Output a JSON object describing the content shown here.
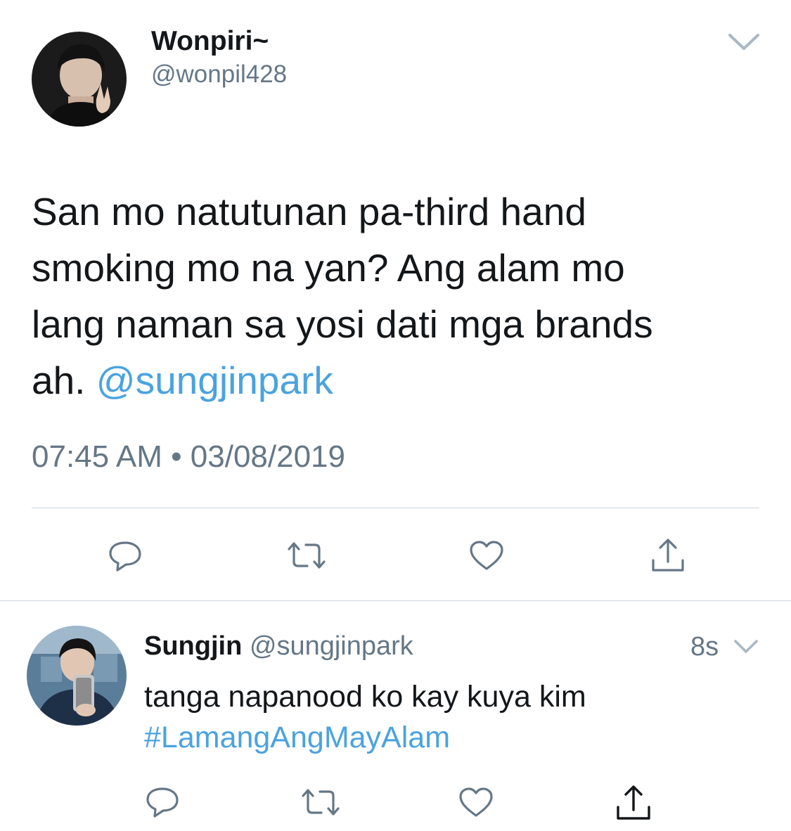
{
  "main_tweet": {
    "display_name": "Wonpiri~",
    "handle": "@wonpil428",
    "text_lines": [
      "San mo natutunan pa-third hand",
      "smoking mo na yan? Ang alam mo",
      "lang naman sa yosi dati mga brands"
    ],
    "text_last_prefix": "ah. ",
    "mention": "@sungjinpark",
    "time": "07:45 AM",
    "separator": "•",
    "date": "03/08/2019"
  },
  "reply": {
    "display_name": "Sungjin",
    "handle": "@sungjinpark",
    "age": "8s",
    "text": "tanga napanood ko kay kuya kim",
    "hashtag": "#LamangAngMayAlam"
  },
  "icons": {
    "dropdown": "chevron-down-icon",
    "reply": "reply-bubble-icon",
    "retweet": "retweet-icon",
    "like": "heart-icon",
    "share": "share-icon"
  },
  "colors": {
    "text": "#14171a",
    "muted": "#657786",
    "link": "#4aa3df",
    "divider": "#cfd6dc"
  }
}
